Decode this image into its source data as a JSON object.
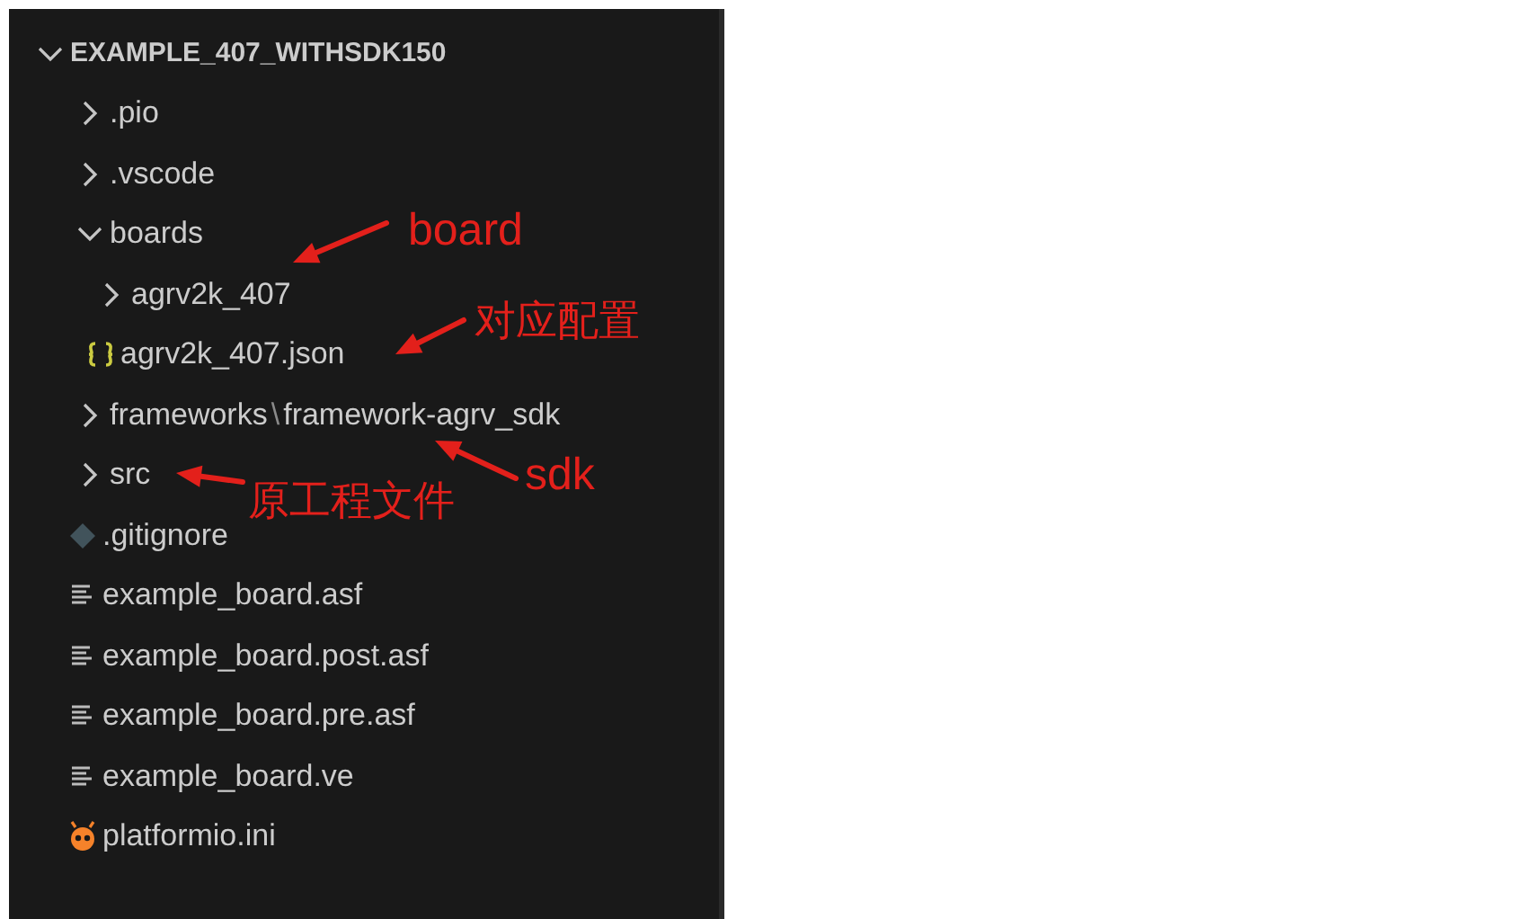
{
  "explorer": {
    "root": {
      "label": "EXAMPLE_407_WITHSDK150",
      "expanded": true,
      "children": [
        {
          "label": ".pio",
          "kind": "folder",
          "expanded": false
        },
        {
          "label": ".vscode",
          "kind": "folder",
          "expanded": false
        },
        {
          "label": "boards",
          "kind": "folder",
          "expanded": true,
          "children": [
            {
              "label": "agrv2k_407",
              "kind": "folder",
              "expanded": false
            },
            {
              "label": "agrv2k_407.json",
              "kind": "json"
            }
          ]
        },
        {
          "label": "frameworks",
          "kind": "folder",
          "expanded": false,
          "compact_child": "framework-agrv_sdk",
          "separator": "\\"
        },
        {
          "label": "src",
          "kind": "folder",
          "expanded": false
        },
        {
          "label": ".gitignore",
          "kind": "git"
        },
        {
          "label": "example_board.asf",
          "kind": "text"
        },
        {
          "label": "example_board.post.asf",
          "kind": "text"
        },
        {
          "label": "example_board.pre.asf",
          "kind": "text"
        },
        {
          "label": "example_board.ve",
          "kind": "text"
        },
        {
          "label": "platformio.ini",
          "kind": "platformio"
        }
      ]
    }
  },
  "annotations": [
    {
      "text": "board"
    },
    {
      "text": "对应配置"
    },
    {
      "text": "sdk"
    },
    {
      "text": "原工程文件"
    }
  ]
}
